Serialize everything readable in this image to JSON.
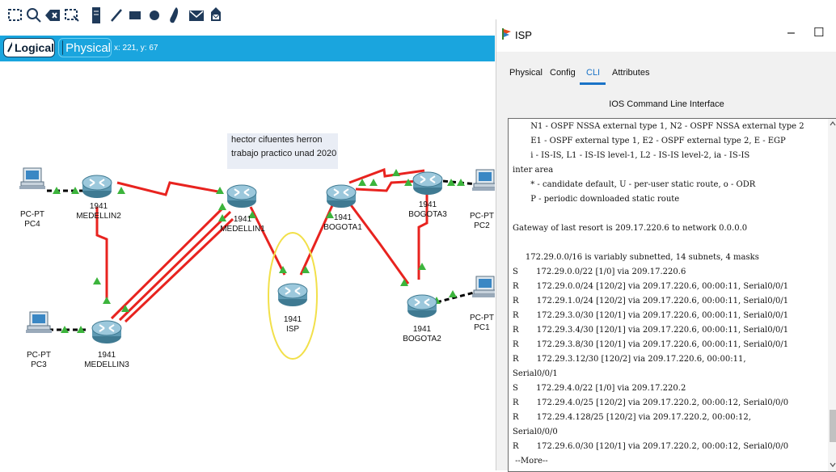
{
  "toolbar": {
    "icons": [
      "select-icon",
      "zoom-icon",
      "delete-icon",
      "resize-icon",
      "note-icon",
      "line-draw-icon",
      "rectangle-icon",
      "ellipse-icon",
      "freeform-icon",
      "inspect-pdu-icon",
      "complex-pdu-icon"
    ]
  },
  "logical_bar": {
    "logical_label": "Logical",
    "physical_label": "Physical",
    "coords": "x: 221, y: 67"
  },
  "note": {
    "line1": "hector cifuentes herron",
    "line2": "trabajo practico unad 2020"
  },
  "devices": {
    "pc4": {
      "type": "PC-PT",
      "name": "PC4"
    },
    "medellin2": {
      "model": "1941",
      "name": "MEDELLIN2"
    },
    "medellin1": {
      "model": "1941",
      "name": "MEDELLIN1"
    },
    "isp": {
      "model": "1941",
      "name": "ISP"
    },
    "bogota1": {
      "model": "1941",
      "name": "BOGOTA1"
    },
    "bogota3": {
      "model": "1941",
      "name": "BOGOTA3"
    },
    "pc2": {
      "type": "PC-PT",
      "name": "PC2"
    },
    "pc3": {
      "type": "PC-PT",
      "name": "PC3"
    },
    "medellin3": {
      "model": "1941",
      "name": "MEDELLIN3"
    },
    "bogota2": {
      "model": "1941",
      "name": "BOGOTA2"
    },
    "pc1": {
      "type": "PC-PT",
      "name": "PC1"
    }
  },
  "window": {
    "title": "ISP",
    "minimize": "–",
    "maximize": "☐",
    "tabs": [
      "Physical",
      "Config",
      "CLI",
      "Attributes"
    ],
    "active_tab": "CLI",
    "cli_header": "IOS Command Line Interface",
    "console_lines": [
      "       N1 - OSPF NSSA external type 1, N2 - OSPF NSSA external type 2",
      "       E1 - OSPF external type 1, E2 - OSPF external type 2, E - EGP",
      "       i - IS-IS, L1 - IS-IS level-1, L2 - IS-IS level-2, ia - IS-IS",
      "inter area",
      "       * - candidate default, U - per-user static route, o - ODR",
      "       P - periodic downloaded static route",
      "",
      "Gateway of last resort is 209.17.220.6 to network 0.0.0.0",
      "",
      "     172.29.0.0/16 is variably subnetted, 14 subnets, 4 masks",
      "S       172.29.0.0/22 [1/0] via 209.17.220.6",
      "R       172.29.0.0/24 [120/2] via 209.17.220.6, 00:00:11, Serial0/0/1",
      "R       172.29.1.0/24 [120/2] via 209.17.220.6, 00:00:11, Serial0/0/1",
      "R       172.29.3.0/30 [120/1] via 209.17.220.6, 00:00:11, Serial0/0/1",
      "R       172.29.3.4/30 [120/1] via 209.17.220.6, 00:00:11, Serial0/0/1",
      "R       172.29.3.8/30 [120/1] via 209.17.220.6, 00:00:11, Serial0/0/1",
      "R       172.29.3.12/30 [120/2] via 209.17.220.6, 00:00:11,",
      "Serial0/0/1",
      "S       172.29.4.0/22 [1/0] via 209.17.220.2",
      "R       172.29.4.0/25 [120/2] via 209.17.220.2, 00:00:12, Serial0/0/0",
      "R       172.29.4.128/25 [120/2] via 209.17.220.2, 00:00:12,",
      "Serial0/0/0",
      "R       172.29.6.0/30 [120/1] via 209.17.220.2, 00:00:12, Serial0/0/0",
      " --More--"
    ]
  },
  "colors": {
    "logical_bar": "#1aa5de",
    "serial_link": "#e8231f",
    "ethernet_link": "#000000",
    "link_up": "#3cb43c"
  }
}
